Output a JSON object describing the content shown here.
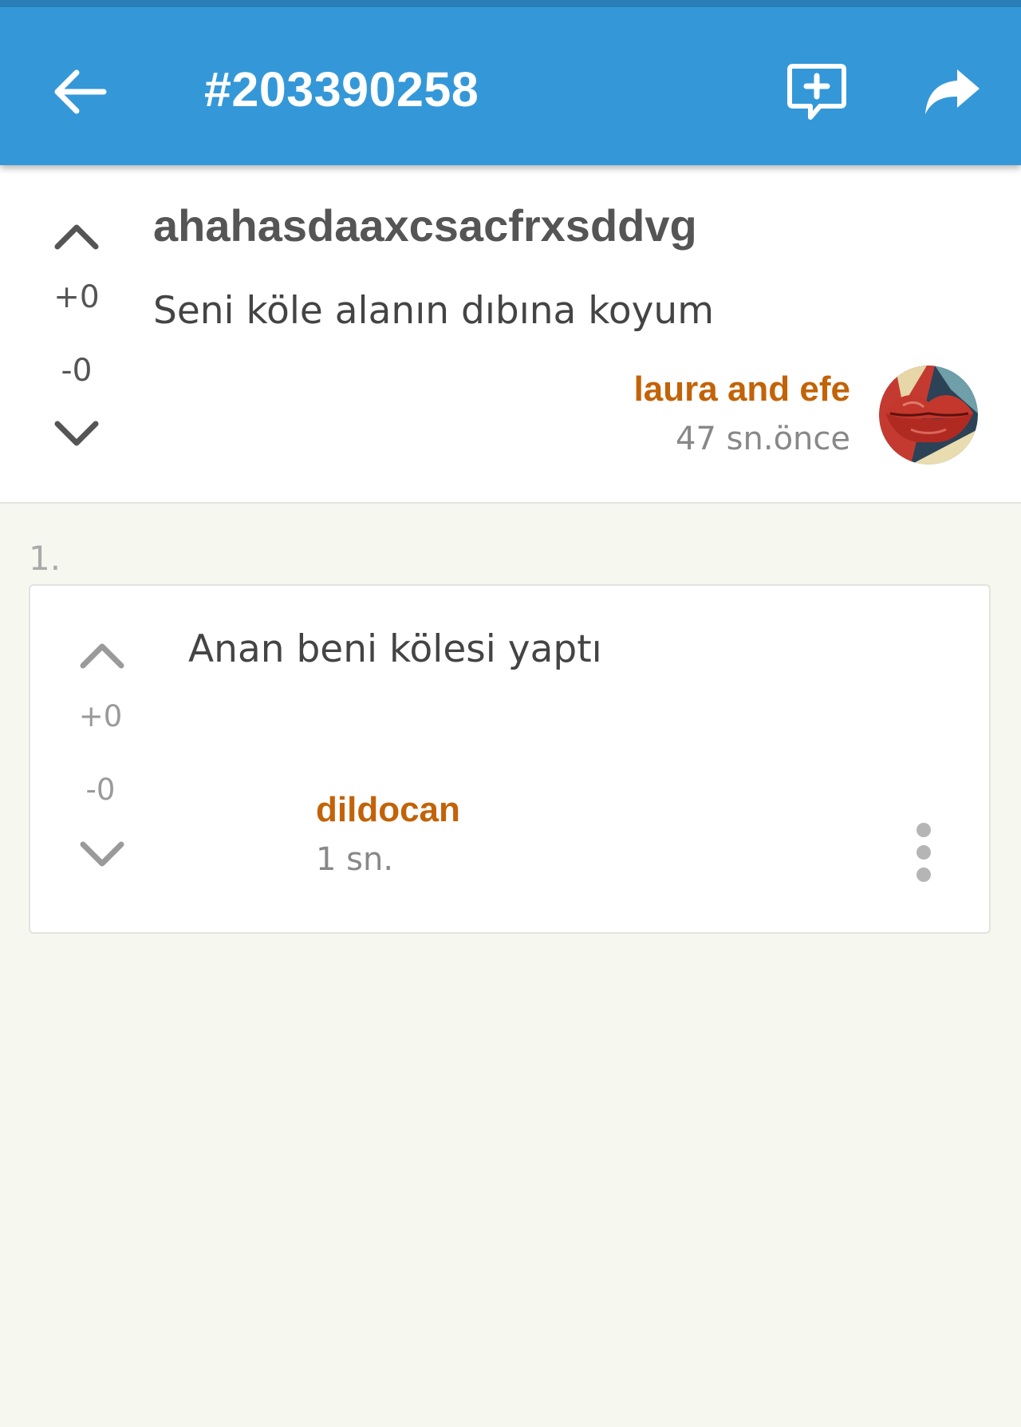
{
  "app_bar": {
    "entry_id": "#203390258",
    "back_icon": "arrow-left-icon",
    "add_comment_icon": "comment-add-icon",
    "share_icon": "share-icon",
    "color": "#3498d8"
  },
  "entry": {
    "title": "ahahasdaaxcsacfrxsddvg",
    "text": "Seni köle alanın dıbına koyum",
    "upvotes": "+0",
    "downvotes": "-0",
    "author": "laura and efe",
    "timestamp": "47 sn.önce",
    "author_color": "#c26308"
  },
  "comments": [
    {
      "index": "1.",
      "text": "Anan beni kölesi yaptı",
      "upvotes": "+0",
      "downvotes": "-0",
      "author": "dildocan",
      "timestamp": "1 sn."
    }
  ]
}
